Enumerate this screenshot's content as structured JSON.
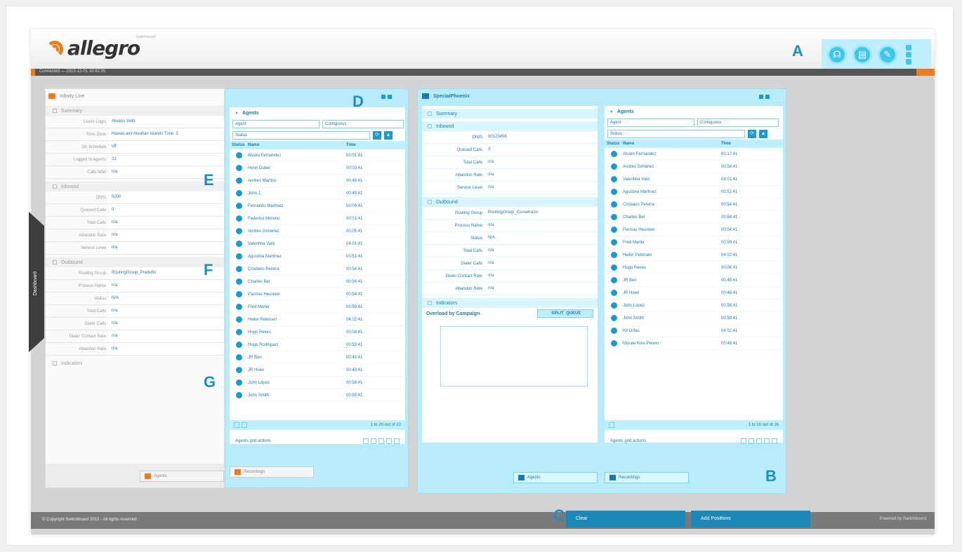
{
  "app": {
    "logo_text": "allegro",
    "logo_sub": "Switchboard",
    "status_text": "Connected — 2013-12-01 10:42:35",
    "side_tab_label": "Dashboard",
    "copyright": "© Copyright Switchboard 2013 - All rights reserved",
    "powered_by": "Powered by Switchboard",
    "footer_buttons": [
      "Clear",
      "Add Positions"
    ]
  },
  "markers": {
    "A": "A",
    "B": "B",
    "C": "C",
    "D": "D",
    "E": "E",
    "F": "F",
    "G": "G"
  },
  "header_icons": [
    "headset-icon",
    "book-icon",
    "wrench-icon"
  ],
  "left_panel": {
    "title": "Infinity Line",
    "summary": {
      "label": "Summary",
      "rows": [
        {
          "label": "Users Login",
          "value": "Always Valid"
        },
        {
          "label": "Time Zone",
          "value": "Hawaii and Aleutian Islands Time, 3"
        },
        {
          "label": "On Schedule",
          "value": "off"
        },
        {
          "label": "Logged In Agents",
          "value": "22"
        },
        {
          "label": "Calls Wait",
          "value": "n/a"
        }
      ]
    },
    "inbound": {
      "label": "Inbound",
      "rows": [
        {
          "label": "DNIS",
          "value": "5000"
        },
        {
          "label": "Queued Calls",
          "value": "0"
        },
        {
          "label": "Total Calls",
          "value": "n/a"
        },
        {
          "label": "Abandon Rate",
          "value": "n/a"
        },
        {
          "label": "Service Level",
          "value": "n/a"
        }
      ]
    },
    "outbound": {
      "label": "Outbound",
      "rows": [
        {
          "label": "Routing Group",
          "value": "RoutingGroup_Predefin"
        },
        {
          "label": "Process Name",
          "value": "n/a"
        },
        {
          "label": "Status",
          "value": "N/A"
        },
        {
          "label": "Total Calls",
          "value": "n/a"
        },
        {
          "label": "Dialer Calls",
          "value": "n/a"
        },
        {
          "label": "Dialer Contact Rate",
          "value": "n/a"
        },
        {
          "label": "Abandon Rate",
          "value": "n/a"
        }
      ]
    },
    "indicators_label": "Indicators",
    "buttons": [
      "Agents",
      "Recordings"
    ]
  },
  "agents_left": {
    "section": "Agents",
    "filter_agent": "Agent",
    "filter_mode": "Contiguous",
    "filter_status": "Status",
    "columns": [
      "Status",
      "Name",
      "Time"
    ],
    "rows": [
      {
        "name": "Alvaro Fernandez",
        "time": "00:01:41"
      },
      {
        "name": "Henri Dubel",
        "time": "00:03:41"
      },
      {
        "name": "Andres Martins",
        "time": "00:48:41"
      },
      {
        "name": "John J.",
        "time": "00:49:41"
      },
      {
        "name": "Fernando Martinez",
        "time": "00:09:41"
      },
      {
        "name": "Federico Moreno",
        "time": "00:01:41"
      },
      {
        "name": "Andres Giménez",
        "time": "00:05:41"
      },
      {
        "name": "Valentina Vaid",
        "time": "04:01:41"
      },
      {
        "name": "Agustina Martinez",
        "time": "00:51:41"
      },
      {
        "name": "Cristiano Pereira",
        "time": "00:54:41"
      },
      {
        "name": "Charles Bel",
        "time": "00:54:41"
      },
      {
        "name": "Parmas Heureter",
        "time": "00:54:41"
      },
      {
        "name": "Fred Marler",
        "time": "00:59:41"
      },
      {
        "name": "Heiler Petersen",
        "time": "04:02:41"
      },
      {
        "name": "Hugo Reves",
        "time": "00:08:41"
      },
      {
        "name": "Hugo Rodriguez",
        "time": "00:53:41"
      },
      {
        "name": "JR Ben",
        "time": "00:48:41"
      },
      {
        "name": "JR Hoen",
        "time": "00:48:41"
      },
      {
        "name": "John Lopez",
        "time": "00:58:41"
      },
      {
        "name": "John Smith",
        "time": "00:59:41"
      }
    ],
    "pager": "1 to 20 out of 22",
    "grid_options": "Agents grid actions"
  },
  "special_panel": {
    "title": "SpecialPhoenix",
    "summary_label": "Summary",
    "inbound": {
      "label": "Inbound",
      "rows": [
        {
          "label": "DNIS",
          "value": "00123456"
        },
        {
          "label": "Queued Calls",
          "value": "0"
        },
        {
          "label": "Total Calls",
          "value": "n/a"
        },
        {
          "label": "Abandon Rate",
          "value": "n/a"
        },
        {
          "label": "Service Level",
          "value": "n/a"
        }
      ]
    },
    "outbound": {
      "label": "Outbound",
      "rows": [
        {
          "label": "Routing Group",
          "value": "RoutingGroup_Conversion"
        },
        {
          "label": "Process Name",
          "value": "n/a"
        },
        {
          "label": "Status",
          "value": "N/A"
        },
        {
          "label": "Total Calls",
          "value": "n/a"
        },
        {
          "label": "Dialer Calls",
          "value": "n/a"
        },
        {
          "label": "Dialer Contact Rate",
          "value": "n/a"
        },
        {
          "label": "Abandon Rate",
          "value": "n/a"
        }
      ]
    },
    "indicators_label": "Indicators",
    "overload_label": "Overload by Campaign",
    "overload_button": "SPLIT_QUEUE",
    "buttons": [
      "Agents",
      "Recordings"
    ]
  },
  "agents_right": {
    "section": "Agents",
    "filter_agent": "Agent",
    "filter_mode": "Contiguous",
    "filter_status": "Status",
    "columns": [
      "Status",
      "Name",
      "Time"
    ],
    "rows": [
      {
        "name": "Alvaro Fernandez",
        "time": "00:17:41"
      },
      {
        "name": "Andres Giménez",
        "time": "00:58:41"
      },
      {
        "name": "Valentina Vaid",
        "time": "04:01:41"
      },
      {
        "name": "Agustina Martinez",
        "time": "00:51:41"
      },
      {
        "name": "Cristiano Pereira",
        "time": "00:54:41"
      },
      {
        "name": "Charles Bel",
        "time": "00:54:41"
      },
      {
        "name": "Parmas Heureter",
        "time": "00:54:41"
      },
      {
        "name": "Fred Marler",
        "time": "00:59:41"
      },
      {
        "name": "Heiler Petersen",
        "time": "04:02:41"
      },
      {
        "name": "Hugo Reves",
        "time": "00:08:41"
      },
      {
        "name": "JR Ben",
        "time": "00:48:41"
      },
      {
        "name": "JR Hoen",
        "time": "00:48:41"
      },
      {
        "name": "John Lopez",
        "time": "00:58:41"
      },
      {
        "name": "John Smith",
        "time": "00:59:41"
      },
      {
        "name": "Kit Lirfau",
        "time": "04:02:41"
      },
      {
        "name": "Morale Kiev-Penen",
        "time": "00:48:41"
      }
    ],
    "pager": "1 to 16 out of 16",
    "grid_options": "Agents grid actions"
  }
}
